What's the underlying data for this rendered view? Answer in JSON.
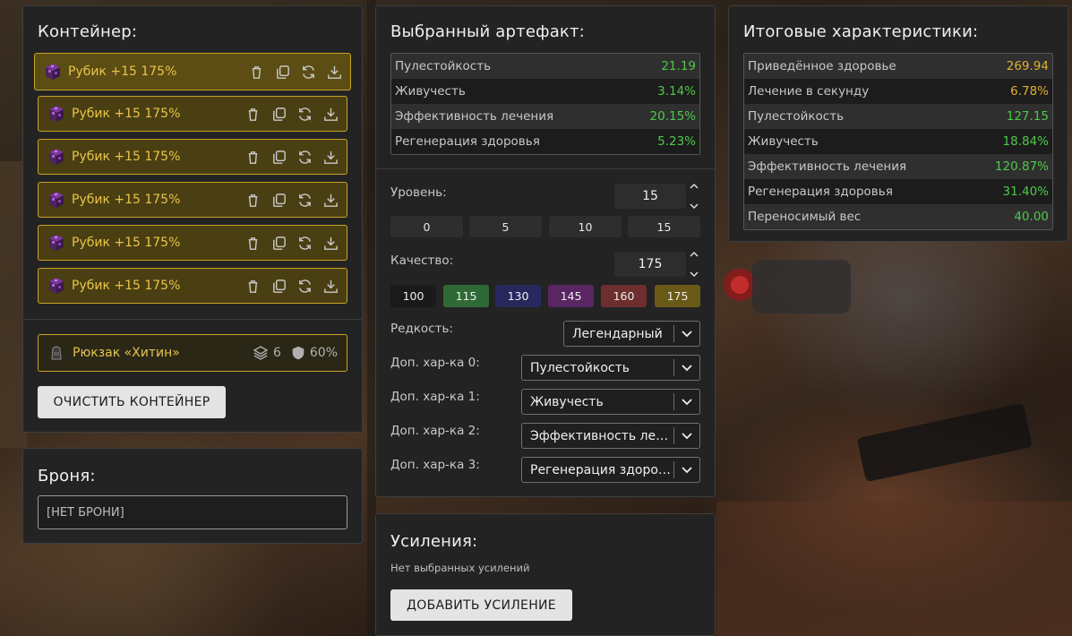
{
  "container": {
    "title": "Контейнер:",
    "items": [
      {
        "label": "Рубик +15 175%"
      },
      {
        "label": "Рубик +15 175%"
      },
      {
        "label": "Рубик +15 175%"
      },
      {
        "label": "Рубик +15 175%"
      },
      {
        "label": "Рубик +15 175%"
      },
      {
        "label": "Рубик +15 175%"
      }
    ],
    "backpack": {
      "name": "Рюкзак «Хитин»",
      "slots": "6",
      "protection": "60%"
    },
    "clear_label": "ОЧИСТИТЬ КОНТЕЙНЕР"
  },
  "armor": {
    "title": "Броня:",
    "value": "[НЕТ БРОНИ]"
  },
  "artifact": {
    "title": "Выбранный артефакт:",
    "stats": [
      {
        "label": "Пулестойкость",
        "value": "21.19"
      },
      {
        "label": "Живучесть",
        "value": "3.14%"
      },
      {
        "label": "Эффективность лечения",
        "value": "20.15%"
      },
      {
        "label": "Регенерация здоровья",
        "value": "5.23%"
      }
    ],
    "level": {
      "label": "Уровень:",
      "value": "15",
      "presets": [
        "0",
        "5",
        "10",
        "15"
      ]
    },
    "quality": {
      "label": "Качество:",
      "value": "175",
      "presets": [
        {
          "label": "100",
          "color": "#1a1a1a"
        },
        {
          "label": "115",
          "color": "#2f6a34"
        },
        {
          "label": "130",
          "color": "#28285e"
        },
        {
          "label": "145",
          "color": "#5a2563"
        },
        {
          "label": "160",
          "color": "#6e2e2e"
        },
        {
          "label": "175",
          "color": "#6a5a18"
        }
      ]
    },
    "rarity": {
      "label": "Редкость:",
      "value": "Легендарный"
    },
    "extras": [
      {
        "label": "Доп. хар-ка 0:",
        "value": "Пулестойкость"
      },
      {
        "label": "Доп. хар-ка 1:",
        "value": "Живучесть"
      },
      {
        "label": "Доп. хар-ка 2:",
        "value": "Эффективность лечения"
      },
      {
        "label": "Доп. хар-ка 3:",
        "value": "Регенерация здоровья"
      }
    ]
  },
  "boosts": {
    "title": "Усиления:",
    "empty_text": "Нет выбранных усилений",
    "add_label": "ДОБАВИТЬ УСИЛЕНИЕ"
  },
  "totals": {
    "title": "Итоговые характеристики:",
    "stats": [
      {
        "label": "Приведённое здоровье",
        "value": "269.94",
        "color": "#e0b030"
      },
      {
        "label": "Лечение в секунду",
        "value": "6.78%",
        "color": "#e0b030"
      },
      {
        "label": "Пулестойкость",
        "value": "127.15",
        "color": "#4fc94a"
      },
      {
        "label": "Живучесть",
        "value": "18.84%",
        "color": "#4fc94a"
      },
      {
        "label": "Эффективность лечения",
        "value": "120.87%",
        "color": "#4fc94a"
      },
      {
        "label": "Регенерация здоровья",
        "value": "31.40%",
        "color": "#4fc94a"
      },
      {
        "label": "Переносимый вес",
        "value": "40.00",
        "color": "#4fc94a"
      }
    ]
  },
  "icons": {
    "artifact": "rubik-cube-icon",
    "actions": [
      "trash-icon",
      "copy-icon",
      "refresh-icon",
      "download-icon"
    ],
    "backpack": "backpack-icon",
    "slots": "layers-icon",
    "protection": "shield-icon"
  }
}
